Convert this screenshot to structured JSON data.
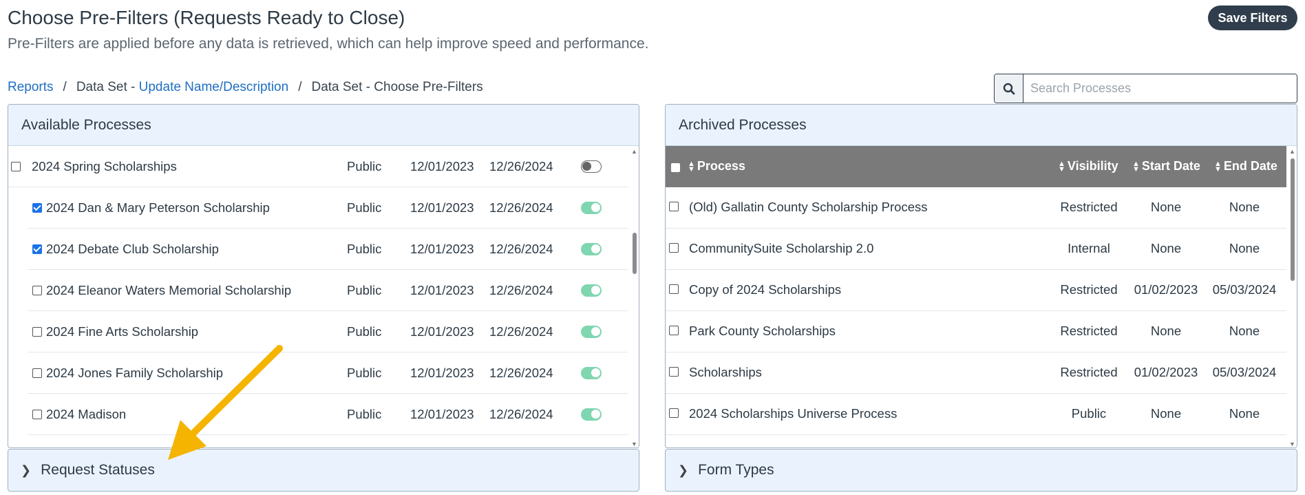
{
  "header": {
    "title": "Choose Pre-Filters (Requests Ready to Close)",
    "subtitle": "Pre-Filters are applied before any data is retrieved, which can help improve speed and performance.",
    "save_label": "Save Filters"
  },
  "breadcrumb": {
    "reports": "Reports",
    "data_set_prefix": "Data Set - ",
    "update_link": "Update Name/Description",
    "current": "Data Set - Choose Pre-Filters",
    "separator": "/"
  },
  "search": {
    "placeholder": "Search Processes",
    "icon": "search-icon"
  },
  "available": {
    "title": "Available Processes",
    "rows": [
      {
        "name": "2024 Spring Scholarships",
        "visibility": "Public",
        "start": "12/01/2023",
        "end": "12/26/2024",
        "checked": false,
        "active": false,
        "child": false
      },
      {
        "name": "2024 Dan & Mary Peterson Scholarship",
        "visibility": "Public",
        "start": "12/01/2023",
        "end": "12/26/2024",
        "checked": true,
        "active": true,
        "child": true
      },
      {
        "name": "2024 Debate Club Scholarship",
        "visibility": "Public",
        "start": "12/01/2023",
        "end": "12/26/2024",
        "checked": true,
        "active": true,
        "child": true
      },
      {
        "name": "2024 Eleanor Waters Memorial Scholarship",
        "visibility": "Public",
        "start": "12/01/2023",
        "end": "12/26/2024",
        "checked": false,
        "active": true,
        "child": true
      },
      {
        "name": "2024 Fine Arts Scholarship",
        "visibility": "Public",
        "start": "12/01/2023",
        "end": "12/26/2024",
        "checked": false,
        "active": true,
        "child": true
      },
      {
        "name": "2024 Jones Family Scholarship",
        "visibility": "Public",
        "start": "12/01/2023",
        "end": "12/26/2024",
        "checked": false,
        "active": true,
        "child": true
      },
      {
        "name": "2024 Madison",
        "visibility": "Public",
        "start": "12/01/2023",
        "end": "12/26/2024",
        "checked": false,
        "active": true,
        "child": true
      }
    ]
  },
  "archived": {
    "title": "Archived Processes",
    "columns": {
      "process": "Process",
      "visibility": "Visibility",
      "start": "Start Date",
      "end": "End Date"
    },
    "rows": [
      {
        "name": "(Old) Gallatin County Scholarship Process",
        "visibility": "Restricted",
        "start": "None",
        "end": "None"
      },
      {
        "name": "CommunitySuite Scholarship 2.0",
        "visibility": "Internal",
        "start": "None",
        "end": "None"
      },
      {
        "name": "Copy of 2024 Scholarships",
        "visibility": "Restricted",
        "start": "01/02/2023",
        "end": "05/03/2024"
      },
      {
        "name": "Park County Scholarships",
        "visibility": "Restricted",
        "start": "None",
        "end": "None"
      },
      {
        "name": "Scholarships",
        "visibility": "Restricted",
        "start": "01/02/2023",
        "end": "05/03/2024"
      },
      {
        "name": "2024 Scholarships Universe Process",
        "visibility": "Public",
        "start": "None",
        "end": "None"
      }
    ]
  },
  "accordions": {
    "left": "Request Statuses",
    "right": "Form Types"
  },
  "colors": {
    "accent_arrow": "#f5b400",
    "toggle_on": "#7fd6b0",
    "header_bg": "#eaf3fd",
    "table_head": "#7a7a7a",
    "button": "#2f3d4c"
  }
}
